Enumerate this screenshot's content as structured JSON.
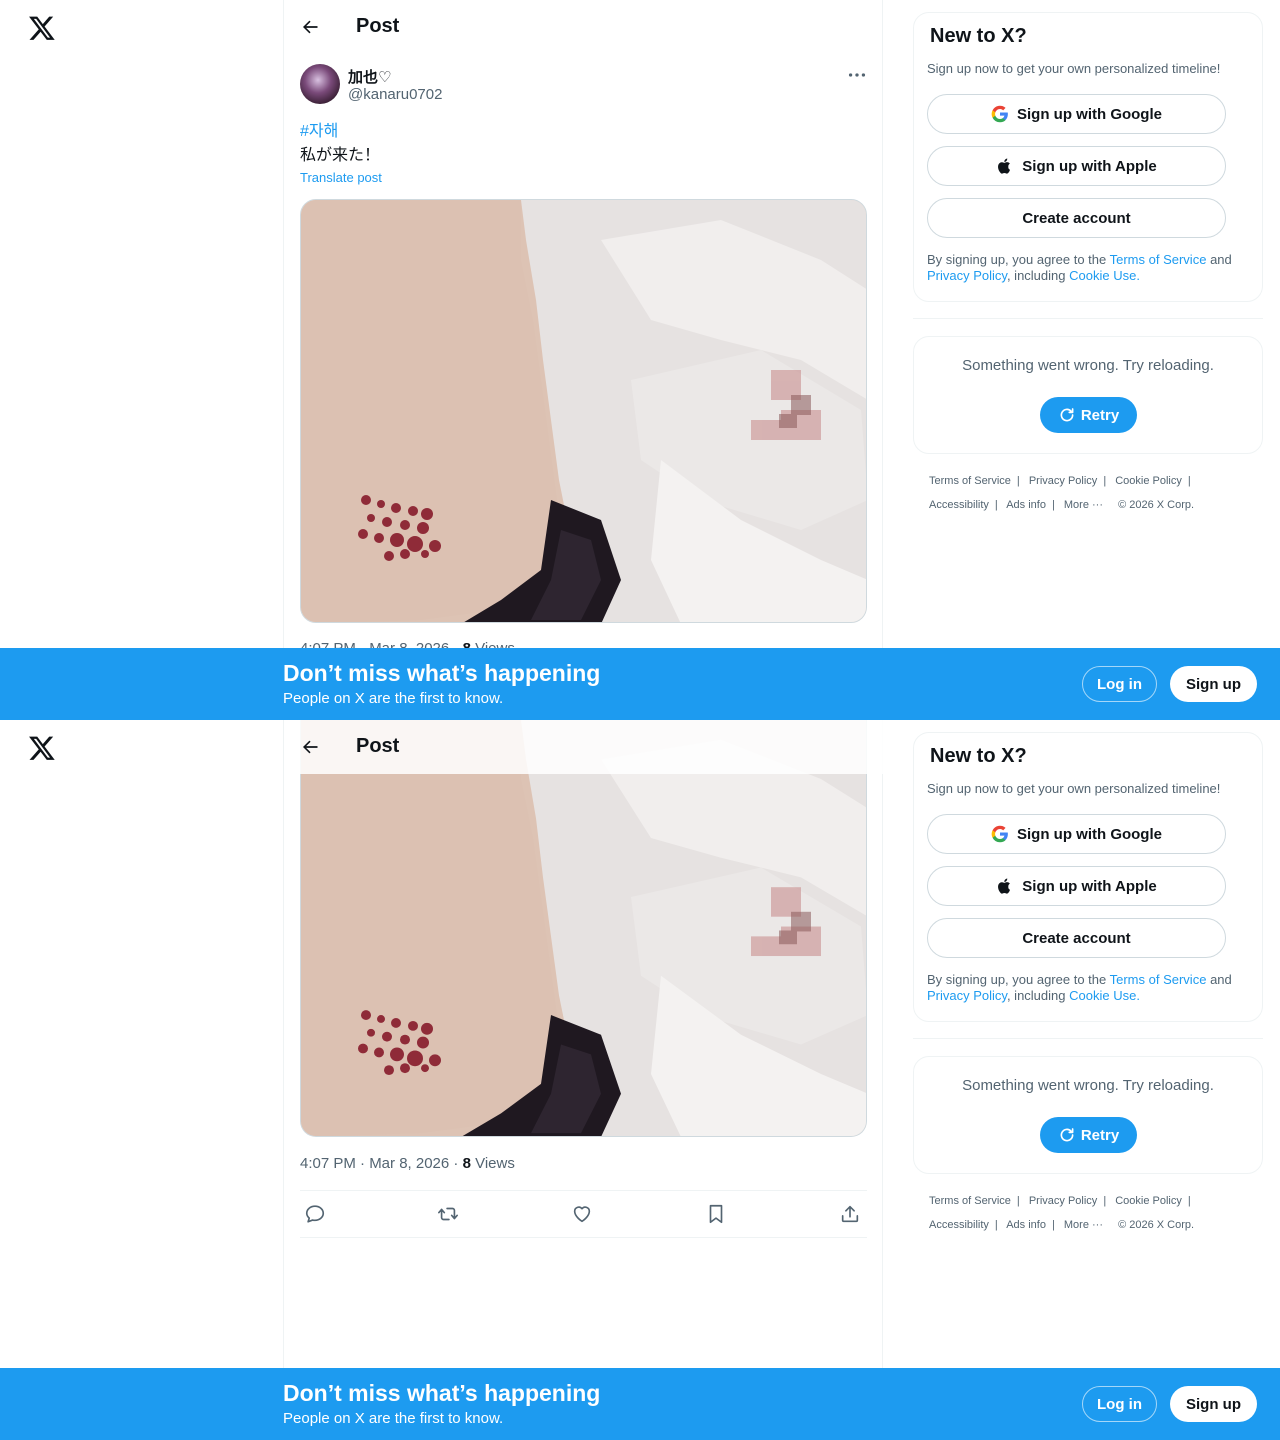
{
  "header": {
    "title": "Post"
  },
  "post": {
    "author_name": "加也♡",
    "author_handle": "@kanaru0702",
    "hashtag": "#자해",
    "text": "私が来た！",
    "translate_label": "Translate post",
    "time": "4:07 PM · Mar 8, 2026",
    "views_count": "8",
    "views_label": "Views"
  },
  "signup_card": {
    "title": "New to X?",
    "subtitle": "Sign up now to get your own personalized timeline!",
    "google_label": "Sign up with Google",
    "apple_label": "Sign up with Apple",
    "create_label": "Create account",
    "legal_prefix": "By signing up, you agree to the",
    "terms_link": "Terms of Service",
    "and_text": "and",
    "privacy_link": "Privacy Policy",
    "including_text": ", including",
    "cookie_link": "Cookie Use."
  },
  "error_card": {
    "message": "Something went wrong. Try reloading.",
    "retry_label": "Retry"
  },
  "footer": {
    "terms": "Terms of Service",
    "privacy": "Privacy Policy",
    "cookie": "Cookie Policy",
    "accessibility": "Accessibility",
    "ads": "Ads info",
    "more": "More ···",
    "copyright": "© 2026 X Corp."
  },
  "banner": {
    "title": "Don’t miss what’s happening",
    "subtitle": "People on X are the first to know.",
    "login_label": "Log in",
    "signup_label": "Sign up"
  },
  "icons": [
    "x-logo-icon",
    "back-arrow-icon",
    "more-icon",
    "reply-icon",
    "repost-icon",
    "like-icon",
    "bookmark-icon",
    "share-icon",
    "google-icon",
    "apple-icon",
    "refresh-icon"
  ],
  "colors": {
    "accent": "#1d9bf0",
    "text_primary": "#0f1419",
    "text_secondary": "#536471",
    "border": "#eff3f4"
  }
}
